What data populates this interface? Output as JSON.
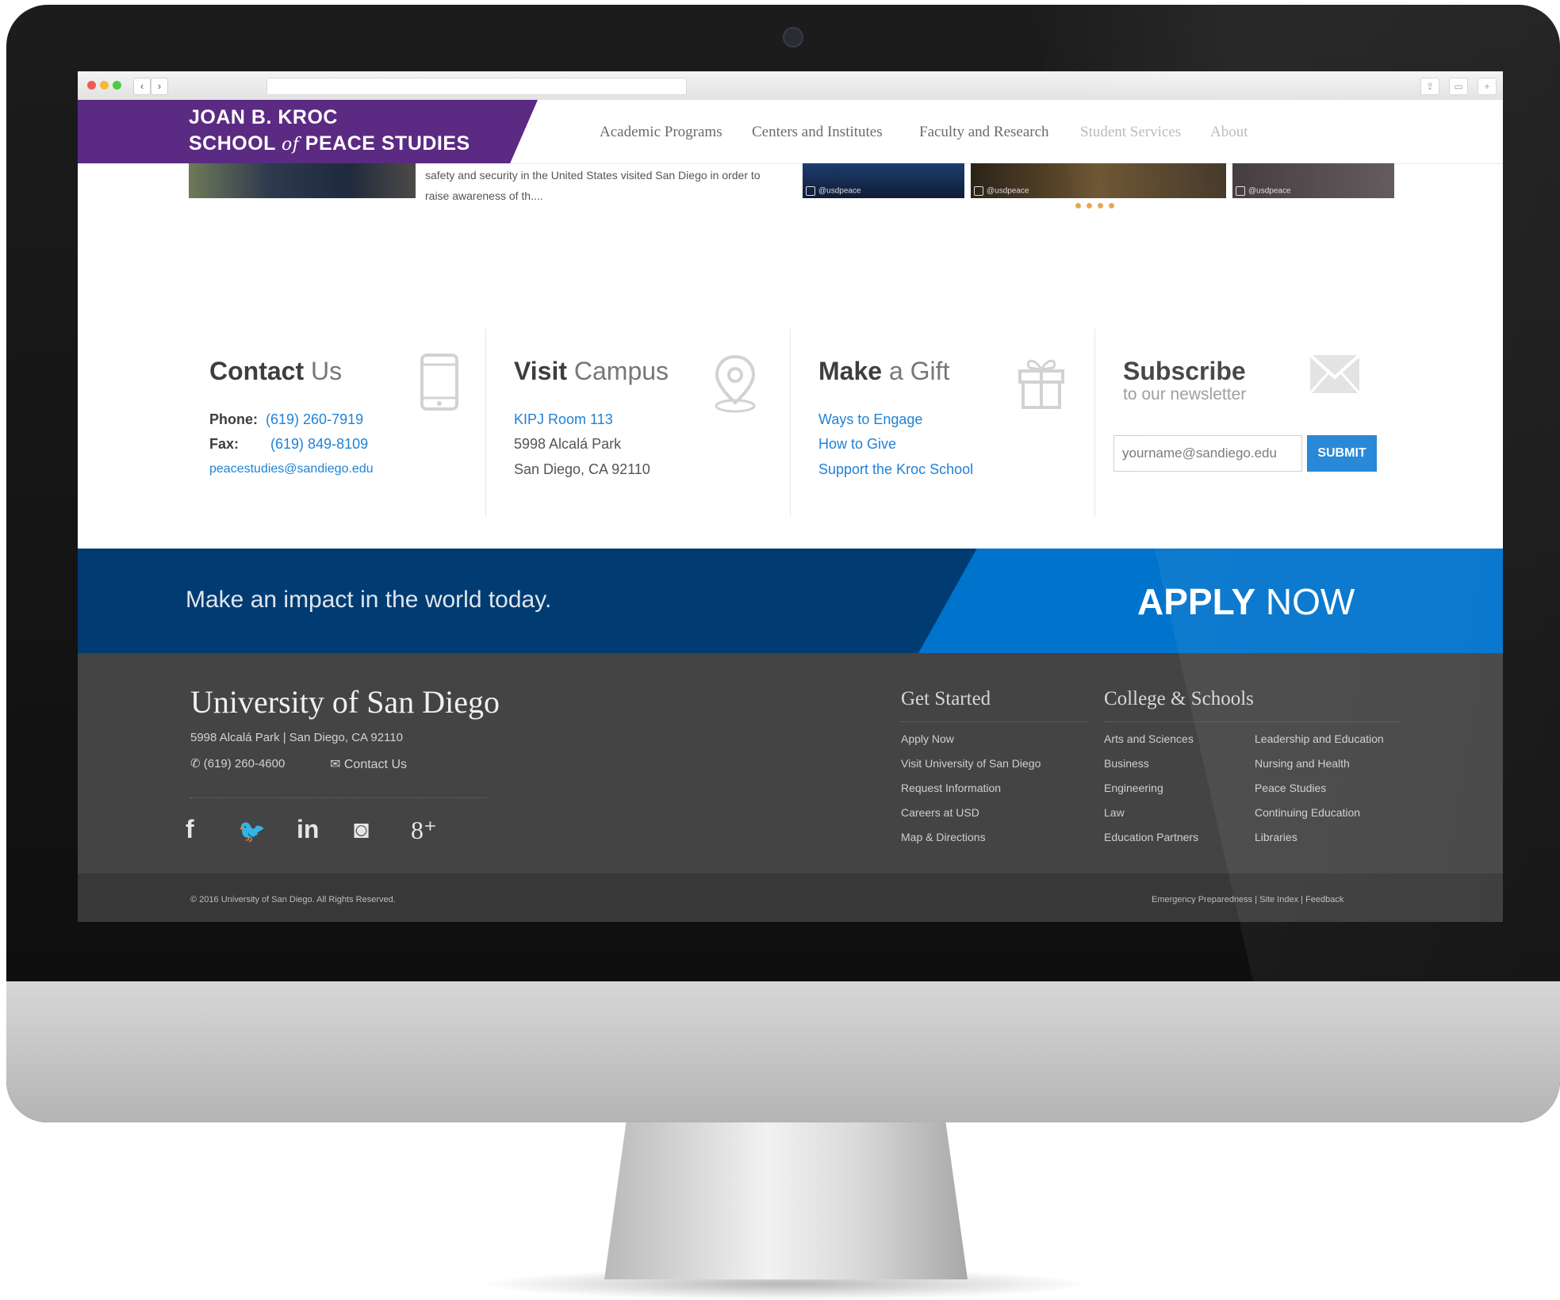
{
  "colors": {
    "purple": "#5b2a83",
    "dark_blue": "#003b72",
    "bright_blue": "#0073cc",
    "link_blue": "#1f82d6",
    "footer_gray": "#444444",
    "accent_dot": "#e7a64c"
  },
  "header": {
    "logo_line1": "JOAN B. KROC",
    "logo_line2a": "SCHOOL",
    "logo_of": "of",
    "logo_line2b": "PEACE STUDIES",
    "nav": [
      {
        "label": "Academic Programs"
      },
      {
        "label": "Centers and Institutes"
      },
      {
        "label": "Faculty and Research"
      },
      {
        "label": "Student Services"
      },
      {
        "label": "About"
      }
    ]
  },
  "strip": {
    "news_snippet": "safety and security in the United States visited San Diego in order to raise awareness of th....",
    "instagram_handle": "@usdpeace"
  },
  "contact": {
    "title_bold": "Contact",
    "title_light": " Us",
    "phone_label": "Phone:",
    "phone": "(619) 260-7919",
    "fax_label": "Fax:",
    "fax": "(619) 849-8109",
    "email": "peacestudies@sandiego.edu",
    "icon": "phone-icon"
  },
  "visit": {
    "title_bold": "Visit",
    "title_light": " Campus",
    "room": "KIPJ Room 113",
    "address1": "5998 Alcalá Park",
    "address2": "San Diego, CA 92110",
    "icon": "map-pin-icon"
  },
  "gift": {
    "title_bold": "Make",
    "title_light": " a Gift",
    "links": [
      "Ways to Engage",
      "How to Give",
      "Support the Kroc School"
    ],
    "icon": "gift-icon"
  },
  "subscribe": {
    "title": "Subscribe",
    "subtitle": "to our newsletter",
    "placeholder": "yourname@sandiego.edu",
    "submit": "SUBMIT",
    "icon": "envelope-icon"
  },
  "apply": {
    "tagline": "Make an impact in the world today.",
    "apply_bold": "APPLY",
    "apply_light": " NOW"
  },
  "footer": {
    "university": "University of San Diego",
    "address": "5998 Alcalá Park  |  San Diego, CA 92110",
    "phone": "(619) 260-4600",
    "contact": "Contact Us",
    "social": [
      {
        "name": "facebook-icon",
        "glyph": "f"
      },
      {
        "name": "twitter-icon",
        "glyph": "🐦"
      },
      {
        "name": "linkedin-icon",
        "glyph": "in"
      },
      {
        "name": "instagram-icon",
        "glyph": "◙"
      },
      {
        "name": "google-plus-icon",
        "glyph": "8⁺"
      }
    ],
    "get_started": {
      "title": "Get Started",
      "links": [
        "Apply Now",
        "Visit University of San Diego",
        "Request Information",
        "Careers at USD",
        "Map & Directions"
      ]
    },
    "colleges": {
      "title": "College & Schools",
      "col1": [
        "Arts and Sciences",
        "Business",
        "Engineering",
        "Law",
        "Education Partners"
      ],
      "col2": [
        "Leadership and Education",
        "Nursing and Health",
        "Peace Studies",
        "Continuing Education",
        "Libraries"
      ]
    }
  },
  "bottom": {
    "copyright": "© 2016 University of San Diego.  All Rights Reserved.",
    "emergency": "Emergency Preparedness",
    "site_index": "Site Index",
    "feedback": "Feedback",
    "sep": "|"
  }
}
